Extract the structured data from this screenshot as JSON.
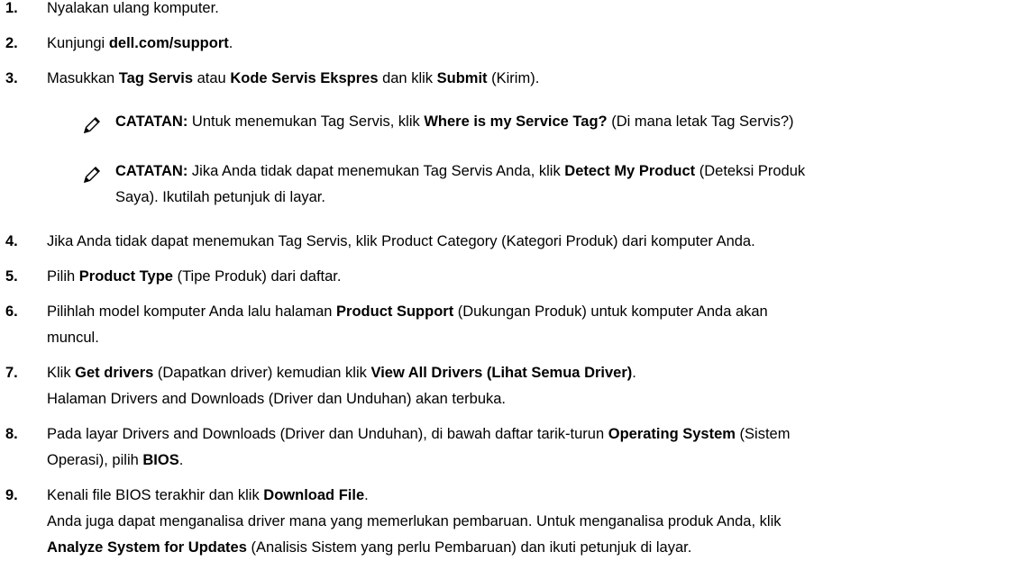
{
  "steps": [
    {
      "num": "1.",
      "text": "Nyalakan ulang komputer."
    },
    {
      "num": "2.",
      "t1": "Kunjungi ",
      "b1": "dell.com/support",
      "t2": "."
    },
    {
      "num": "3.",
      "t1": "Masukkan ",
      "b1": "Tag Servis",
      "t2": " atau ",
      "b2": "Kode Servis Ekspres",
      "t3": " dan klik ",
      "b3": "Submit",
      "t4": " (Kirim)."
    },
    {
      "num": "4.",
      "text": "Jika Anda tidak dapat menemukan Tag Servis, klik Product Category (Kategori Produk) dari komputer Anda."
    },
    {
      "num": "5.",
      "t1": "Pilih ",
      "b1": "Product Type",
      "t2": " (Tipe Produk) dari daftar."
    },
    {
      "num": "6.",
      "t1": "Pilihlah model komputer Anda lalu halaman ",
      "b1": "Product Support",
      "t2": " (Dukungan Produk) untuk komputer Anda akan",
      "t3": "muncul."
    },
    {
      "num": "7.",
      "t1": "Klik ",
      "b1": "Get drivers",
      "t2": " (Dapatkan driver) kemudian klik ",
      "b2": "View All Drivers (Lihat Semua Driver)",
      "t3": ".",
      "sub": "Halaman Drivers and Downloads (Driver dan Unduhan) akan terbuka."
    },
    {
      "num": "8.",
      "t1": "Pada layar Drivers and Downloads (Driver dan Unduhan), di bawah daftar tarik-turun ",
      "b1": "Operating System",
      "t2": " (Sistem",
      "t3": "Operasi), pilih ",
      "b2": "BIOS",
      "t4": "."
    },
    {
      "num": "9.",
      "t1": "Kenali file BIOS terakhir dan klik ",
      "b1": "Download File",
      "t2": ".",
      "sub1": "Anda juga dapat menganalisa driver mana yang memerlukan pembaruan. Untuk menganalisa produk Anda, klik",
      "b2": "Analyze System for Updates",
      "t3": " (Analisis Sistem yang perlu Pembaruan) dan ikuti petunjuk di layar."
    }
  ],
  "notes": [
    {
      "label": "CATATAN:",
      "t1": " Untuk menemukan Tag Servis, klik ",
      "b1": "Where is my Service Tag?",
      "t2": " (Di mana letak Tag Servis?)"
    },
    {
      "label": "CATATAN:",
      "t1": " Jika Anda tidak dapat menemukan Tag Servis Anda, klik ",
      "b1": "Detect My Product",
      "t2": " (Deteksi Produk",
      "t3": "Saya). Ikutilah petunjuk di layar."
    }
  ],
  "icons": {
    "note": "pencil-note-icon"
  },
  "colors": {
    "icon_bg": "#ffffff",
    "icon_fg": "#000000"
  }
}
